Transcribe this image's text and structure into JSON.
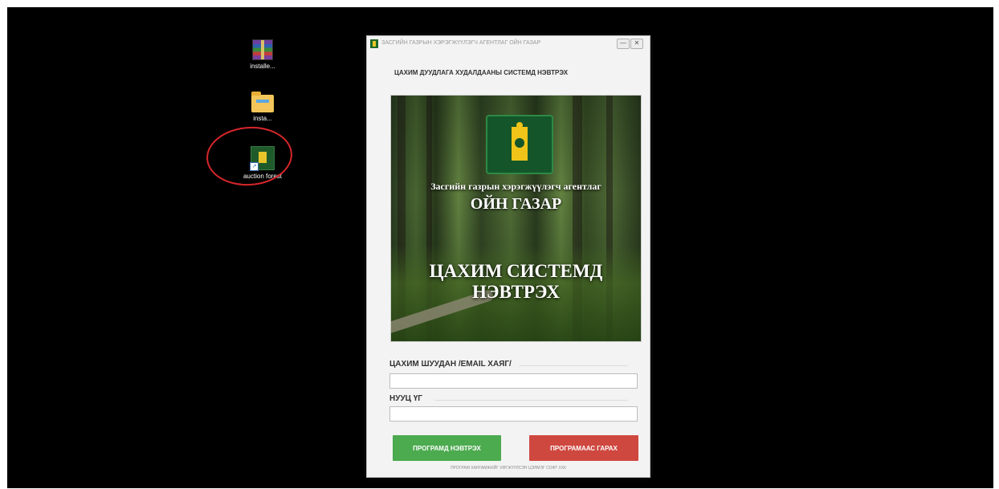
{
  "desktop": {
    "icons": [
      {
        "label": "installe...",
        "icon": "winrar-archive-icon"
      },
      {
        "label": "insta...",
        "icon": "folder-icon"
      },
      {
        "label": "auction forest",
        "icon": "forest-app-shortcut-icon"
      }
    ],
    "annotation_color": "#d6262a"
  },
  "window": {
    "title": "ЗАСГИЙН ГАЗРЫН ХЭРЭГЖҮҮЛЭГЧ АГЕНТЛАГ ОЙН ГАЗАР",
    "minimize_label": "—",
    "close_label": "✕",
    "header": "ЦАХИМ ДУУДЛАГА ХУДАЛДААНЫ СИСТЕМД НЭВТРЭХ",
    "banner": {
      "subtitle": "Засгийн газрын хэрэгжүүлэгч агентлаг",
      "title": "ОЙН ГАЗАР",
      "tagline_line1": "ЦАХИМ СИСТЕМД",
      "tagline_line2": "НЭВТРЭХ"
    },
    "email_label": "ЦАХИМ ШУУДАН /EMAIL ХАЯГ/",
    "email_value": "",
    "password_label": "НУУЦ ҮГ",
    "password_value": "",
    "login_button": "ПРОГРАМД НЭВТРЭХ",
    "exit_button": "ПРОГРАМААС ГАРАХ",
    "footer": "ПРОГРАМ ХАНГАМЖИЙГ ХӨГЖҮҮЛСЭН ЦЭЛМЭГ СОФТ ХХК",
    "colors": {
      "login": "#4caa4f",
      "exit": "#cf4840",
      "emblem": "#14562a",
      "emblem_symbol": "#f0c419"
    }
  }
}
